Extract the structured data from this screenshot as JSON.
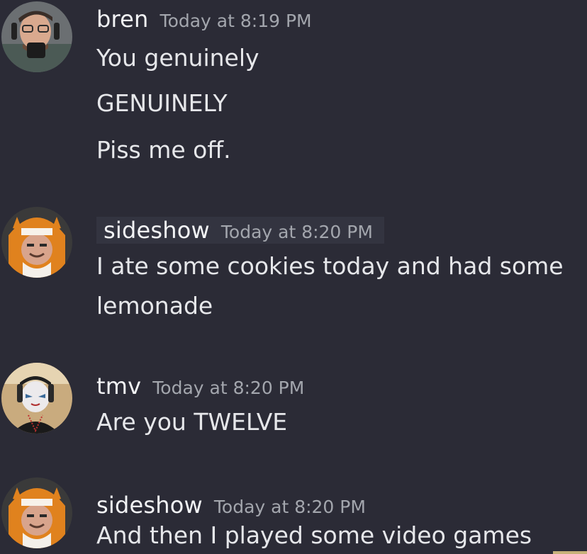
{
  "messages": [
    {
      "author": "bren",
      "timestamp": "Today at 8:19 PM",
      "lines": [
        "You genuinely",
        "GENUINELY",
        "Piss me off."
      ]
    },
    {
      "author": "sideshow",
      "timestamp": "Today at 8:20 PM",
      "lines": [
        "I ate some cookies today and had some",
        "lemonade"
      ]
    },
    {
      "author": "tmv",
      "timestamp": "Today at 8:20 PM",
      "lines": [
        "Are you TWELVE"
      ]
    },
    {
      "author": "sideshow",
      "timestamp": "Today at 8:20 PM",
      "lines": [
        "And then I played some video games"
      ]
    }
  ],
  "colors": {
    "background": "#2b2b36",
    "username": "#f2f3f5",
    "timestamp": "#a3a6ad",
    "message_text": "#e6e7ea"
  }
}
